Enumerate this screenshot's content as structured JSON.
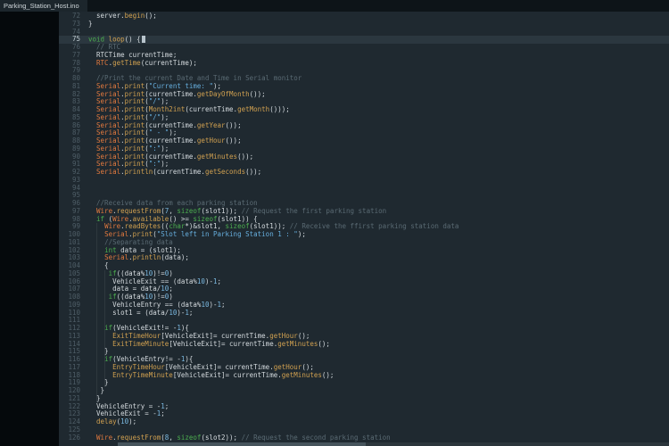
{
  "tab": {
    "title": "Parking_Station_Host.ino"
  },
  "palette": {
    "editor_bg": "#1f2930",
    "tabbar_bg": "#0d1418",
    "tab_bg": "#1c262c",
    "tab_fg": "#cfd6da",
    "strip_bg": "#05090c",
    "fg": "#d4dade",
    "ln_fg": "#4e5d66",
    "ln_active": "#c2cdd3",
    "cur_line": "#2b373f",
    "kw": "#4cae4f",
    "obj": "#e1793e",
    "fn": "#d0a050",
    "str": "#66aedd",
    "num": "#7ab8e0",
    "cmt": "#5a6a73",
    "cursor": "#b8c4cc",
    "scroll_track": "#2c363c",
    "scroll_thumb": "#46545c"
  },
  "editor": {
    "first_line": 72,
    "last_line": 126,
    "lines": [
      {
        "no": 72,
        "tokens": [
          [
            "pln",
            "  server."
          ],
          [
            "fn",
            "begin"
          ],
          [
            "pln",
            "();"
          ]
        ]
      },
      {
        "no": 73,
        "tokens": [
          [
            "pln",
            "}"
          ]
        ]
      },
      {
        "no": 74,
        "tokens": []
      },
      {
        "no": 75,
        "current": true,
        "cursor": true,
        "tokens": [
          [
            "kw",
            "void"
          ],
          [
            "pln",
            " "
          ],
          [
            "fn",
            "loop"
          ],
          [
            "pln",
            "() {"
          ]
        ]
      },
      {
        "no": 76,
        "tokens": [
          [
            "cmt",
            "  // RTC"
          ]
        ]
      },
      {
        "no": 77,
        "tokens": [
          [
            "pln",
            "  RTCTime currentTime;"
          ]
        ]
      },
      {
        "no": 78,
        "tokens": [
          [
            "pln",
            "  "
          ],
          [
            "obj",
            "RTC"
          ],
          [
            "pln",
            "."
          ],
          [
            "fn",
            "getTime"
          ],
          [
            "pln",
            "(currentTime);"
          ]
        ]
      },
      {
        "no": 79,
        "tokens": []
      },
      {
        "no": 80,
        "tokens": [
          [
            "cmt",
            "  //Print the current Date and Time in Serial monitor"
          ]
        ]
      },
      {
        "no": 81,
        "tokens": [
          [
            "pln",
            "  "
          ],
          [
            "obj",
            "Serial"
          ],
          [
            "pln",
            "."
          ],
          [
            "fn",
            "print"
          ],
          [
            "pln",
            "("
          ],
          [
            "str",
            "\"Current time: \""
          ],
          [
            "pln",
            ");"
          ]
        ]
      },
      {
        "no": 82,
        "tokens": [
          [
            "pln",
            "  "
          ],
          [
            "obj",
            "Serial"
          ],
          [
            "pln",
            "."
          ],
          [
            "fn",
            "print"
          ],
          [
            "pln",
            "(currentTime."
          ],
          [
            "fn",
            "getDayOfMonth"
          ],
          [
            "pln",
            "());"
          ]
        ]
      },
      {
        "no": 83,
        "tokens": [
          [
            "pln",
            "  "
          ],
          [
            "obj",
            "Serial"
          ],
          [
            "pln",
            "."
          ],
          [
            "fn",
            "print"
          ],
          [
            "pln",
            "("
          ],
          [
            "str",
            "\"/\""
          ],
          [
            "pln",
            ");"
          ]
        ]
      },
      {
        "no": 84,
        "tokens": [
          [
            "pln",
            "  "
          ],
          [
            "obj",
            "Serial"
          ],
          [
            "pln",
            "."
          ],
          [
            "fn",
            "print"
          ],
          [
            "pln",
            "("
          ],
          [
            "fn",
            "Month2int"
          ],
          [
            "pln",
            "(currentTime."
          ],
          [
            "fn",
            "getMonth"
          ],
          [
            "pln",
            "()));"
          ]
        ]
      },
      {
        "no": 85,
        "tokens": [
          [
            "pln",
            "  "
          ],
          [
            "obj",
            "Serial"
          ],
          [
            "pln",
            "."
          ],
          [
            "fn",
            "print"
          ],
          [
            "pln",
            "("
          ],
          [
            "str",
            "\"/\""
          ],
          [
            "pln",
            ");"
          ]
        ]
      },
      {
        "no": 86,
        "tokens": [
          [
            "pln",
            "  "
          ],
          [
            "obj",
            "Serial"
          ],
          [
            "pln",
            "."
          ],
          [
            "fn",
            "print"
          ],
          [
            "pln",
            "(currentTime."
          ],
          [
            "fn",
            "getYear"
          ],
          [
            "pln",
            "());"
          ]
        ]
      },
      {
        "no": 87,
        "tokens": [
          [
            "pln",
            "  "
          ],
          [
            "obj",
            "Serial"
          ],
          [
            "pln",
            "."
          ],
          [
            "fn",
            "print"
          ],
          [
            "pln",
            "("
          ],
          [
            "str",
            "\" - \""
          ],
          [
            "pln",
            ");"
          ]
        ]
      },
      {
        "no": 88,
        "tokens": [
          [
            "pln",
            "  "
          ],
          [
            "obj",
            "Serial"
          ],
          [
            "pln",
            "."
          ],
          [
            "fn",
            "print"
          ],
          [
            "pln",
            "(currentTime."
          ],
          [
            "fn",
            "getHour"
          ],
          [
            "pln",
            "());"
          ]
        ]
      },
      {
        "no": 89,
        "tokens": [
          [
            "pln",
            "  "
          ],
          [
            "obj",
            "Serial"
          ],
          [
            "pln",
            "."
          ],
          [
            "fn",
            "print"
          ],
          [
            "pln",
            "("
          ],
          [
            "str",
            "\":\""
          ],
          [
            "pln",
            ");"
          ]
        ]
      },
      {
        "no": 90,
        "tokens": [
          [
            "pln",
            "  "
          ],
          [
            "obj",
            "Serial"
          ],
          [
            "pln",
            "."
          ],
          [
            "fn",
            "print"
          ],
          [
            "pln",
            "(currentTime."
          ],
          [
            "fn",
            "getMinutes"
          ],
          [
            "pln",
            "());"
          ]
        ]
      },
      {
        "no": 91,
        "tokens": [
          [
            "pln",
            "  "
          ],
          [
            "obj",
            "Serial"
          ],
          [
            "pln",
            "."
          ],
          [
            "fn",
            "print"
          ],
          [
            "pln",
            "("
          ],
          [
            "str",
            "\":\""
          ],
          [
            "pln",
            ");"
          ]
        ]
      },
      {
        "no": 92,
        "tokens": [
          [
            "pln",
            "  "
          ],
          [
            "obj",
            "Serial"
          ],
          [
            "pln",
            "."
          ],
          [
            "fn",
            "println"
          ],
          [
            "pln",
            "(currentTime."
          ],
          [
            "fn",
            "getSeconds"
          ],
          [
            "pln",
            "());"
          ]
        ]
      },
      {
        "no": 93,
        "tokens": []
      },
      {
        "no": 94,
        "tokens": []
      },
      {
        "no": 95,
        "tokens": []
      },
      {
        "no": 96,
        "tokens": [
          [
            "cmt",
            "  //Receive data from each parking station"
          ]
        ]
      },
      {
        "no": 97,
        "tokens": [
          [
            "pln",
            "  "
          ],
          [
            "obj",
            "Wire"
          ],
          [
            "pln",
            "."
          ],
          [
            "fn",
            "requestFrom"
          ],
          [
            "pln",
            "("
          ],
          [
            "num",
            "7"
          ],
          [
            "pln",
            ", "
          ],
          [
            "kw",
            "sizeof"
          ],
          [
            "pln",
            "(slot1)); "
          ],
          [
            "cmt",
            "// Request the first parking station"
          ]
        ]
      },
      {
        "no": 98,
        "tokens": [
          [
            "pln",
            "  "
          ],
          [
            "kw",
            "if"
          ],
          [
            "pln",
            " ("
          ],
          [
            "obj",
            "Wire"
          ],
          [
            "pln",
            "."
          ],
          [
            "fn",
            "available"
          ],
          [
            "pln",
            "() >= "
          ],
          [
            "kw",
            "sizeof"
          ],
          [
            "pln",
            "(slot1)) {"
          ]
        ]
      },
      {
        "no": 99,
        "tokens": [
          [
            "pln",
            "    "
          ],
          [
            "obj",
            "Wire"
          ],
          [
            "pln",
            "."
          ],
          [
            "fn",
            "readBytes"
          ],
          [
            "pln",
            "(("
          ],
          [
            "kw",
            "char"
          ],
          [
            "pln",
            "*)&slot1, "
          ],
          [
            "kw",
            "sizeof"
          ],
          [
            "pln",
            "(slot1)); "
          ],
          [
            "cmt",
            "// Receive the ffirst parking station data"
          ]
        ]
      },
      {
        "no": 100,
        "tokens": [
          [
            "pln",
            "    "
          ],
          [
            "obj",
            "Serial"
          ],
          [
            "pln",
            "."
          ],
          [
            "fn",
            "print"
          ],
          [
            "pln",
            "("
          ],
          [
            "str",
            "\"Slot left in Parking Station 1 : \""
          ],
          [
            "pln",
            ");"
          ]
        ]
      },
      {
        "no": 101,
        "tokens": [
          [
            "pln",
            "    "
          ],
          [
            "cmt",
            "//Separating data"
          ]
        ]
      },
      {
        "no": 102,
        "tokens": [
          [
            "pln",
            "    "
          ],
          [
            "kw",
            "int"
          ],
          [
            "pln",
            " data = (slot1);"
          ]
        ]
      },
      {
        "no": 103,
        "tokens": [
          [
            "pln",
            "    "
          ],
          [
            "obj",
            "Serial"
          ],
          [
            "pln",
            "."
          ],
          [
            "fn",
            "println"
          ],
          [
            "pln",
            "(data);"
          ]
        ]
      },
      {
        "no": 104,
        "tokens": [
          [
            "pln",
            "    {"
          ]
        ]
      },
      {
        "no": 105,
        "tokens": [
          [
            "pln",
            "     "
          ],
          [
            "kw",
            "if"
          ],
          [
            "pln",
            "((data%"
          ],
          [
            "num",
            "10"
          ],
          [
            "pln",
            ")!="
          ],
          [
            "num",
            "0"
          ],
          [
            "pln",
            ")"
          ]
        ]
      },
      {
        "no": 106,
        "tokens": [
          [
            "pln",
            "      VehicleExit == (data%"
          ],
          [
            "num",
            "10"
          ],
          [
            "pln",
            ")-"
          ],
          [
            "num",
            "1"
          ],
          [
            "pln",
            ";"
          ]
        ]
      },
      {
        "no": 107,
        "tokens": [
          [
            "pln",
            "      data = data/"
          ],
          [
            "num",
            "10"
          ],
          [
            "pln",
            ";"
          ]
        ]
      },
      {
        "no": 108,
        "tokens": [
          [
            "pln",
            "     "
          ],
          [
            "kw",
            "if"
          ],
          [
            "pln",
            "((data%"
          ],
          [
            "num",
            "10"
          ],
          [
            "pln",
            ")!="
          ],
          [
            "num",
            "0"
          ],
          [
            "pln",
            ")"
          ]
        ]
      },
      {
        "no": 109,
        "tokens": [
          [
            "pln",
            "      VehicleEntry == (data%"
          ],
          [
            "num",
            "10"
          ],
          [
            "pln",
            ")-"
          ],
          [
            "num",
            "1"
          ],
          [
            "pln",
            ";"
          ]
        ]
      },
      {
        "no": 110,
        "tokens": [
          [
            "pln",
            "      slot1 = (data/"
          ],
          [
            "num",
            "10"
          ],
          [
            "pln",
            ")-"
          ],
          [
            "num",
            "1"
          ],
          [
            "pln",
            ";"
          ]
        ]
      },
      {
        "no": 111,
        "tokens": []
      },
      {
        "no": 112,
        "tokens": [
          [
            "pln",
            "    "
          ],
          [
            "kw",
            "if"
          ],
          [
            "pln",
            "(VehicleExit!= -"
          ],
          [
            "num",
            "1"
          ],
          [
            "pln",
            "){"
          ]
        ]
      },
      {
        "no": 113,
        "tokens": [
          [
            "pln",
            "      "
          ],
          [
            "fn",
            "ExitTimeHour"
          ],
          [
            "pln",
            "[VehicleExit]= currentTime."
          ],
          [
            "fn",
            "getHour"
          ],
          [
            "pln",
            "();"
          ]
        ]
      },
      {
        "no": 114,
        "tokens": [
          [
            "pln",
            "      "
          ],
          [
            "fn",
            "ExitTimeMinute"
          ],
          [
            "pln",
            "[VehicleExit]= currentTime."
          ],
          [
            "fn",
            "getMinutes"
          ],
          [
            "pln",
            "();"
          ]
        ]
      },
      {
        "no": 115,
        "tokens": [
          [
            "pln",
            "    }"
          ]
        ]
      },
      {
        "no": 116,
        "tokens": [
          [
            "pln",
            "    "
          ],
          [
            "kw",
            "if"
          ],
          [
            "pln",
            "(VehicleEntry!= -"
          ],
          [
            "num",
            "1"
          ],
          [
            "pln",
            "){"
          ]
        ]
      },
      {
        "no": 117,
        "tokens": [
          [
            "pln",
            "      "
          ],
          [
            "fn",
            "EntryTimeHour"
          ],
          [
            "pln",
            "[VehicleExit]= "
          ],
          [
            "pln",
            "currentTime."
          ],
          [
            "fn",
            "getHour"
          ],
          [
            "pln",
            "();"
          ]
        ]
      },
      {
        "no": 118,
        "tokens": [
          [
            "pln",
            "      "
          ],
          [
            "fn",
            "EntryTimeMinute"
          ],
          [
            "pln",
            "[VehicleExit]= currentTime."
          ],
          [
            "fn",
            "getMinutes"
          ],
          [
            "pln",
            "();"
          ]
        ]
      },
      {
        "no": 119,
        "tokens": [
          [
            "pln",
            "    }"
          ]
        ]
      },
      {
        "no": 120,
        "tokens": [
          [
            "pln",
            "   }"
          ]
        ]
      },
      {
        "no": 121,
        "tokens": [
          [
            "pln",
            "  }"
          ]
        ]
      },
      {
        "no": 122,
        "tokens": [
          [
            "pln",
            "  VehicleEntry = -"
          ],
          [
            "num",
            "1"
          ],
          [
            "pln",
            ";"
          ]
        ]
      },
      {
        "no": 123,
        "tokens": [
          [
            "pln",
            "  VehicleExit = -"
          ],
          [
            "num",
            "1"
          ],
          [
            "pln",
            ";"
          ]
        ]
      },
      {
        "no": 124,
        "tokens": [
          [
            "pln",
            "  "
          ],
          [
            "fn",
            "delay"
          ],
          [
            "pln",
            "("
          ],
          [
            "num",
            "10"
          ],
          [
            "pln",
            ");"
          ]
        ]
      },
      {
        "no": 125,
        "tokens": []
      },
      {
        "no": 126,
        "tokens": [
          [
            "pln",
            "  "
          ],
          [
            "obj",
            "Wire"
          ],
          [
            "pln",
            "."
          ],
          [
            "fn",
            "requestFrom"
          ],
          [
            "pln",
            "("
          ],
          [
            "num",
            "8"
          ],
          [
            "pln",
            ", "
          ],
          [
            "kw",
            "sizeof"
          ],
          [
            "pln",
            "(slot2)); "
          ],
          [
            "cmt",
            "// Request the second parking station"
          ]
        ]
      }
    ]
  }
}
